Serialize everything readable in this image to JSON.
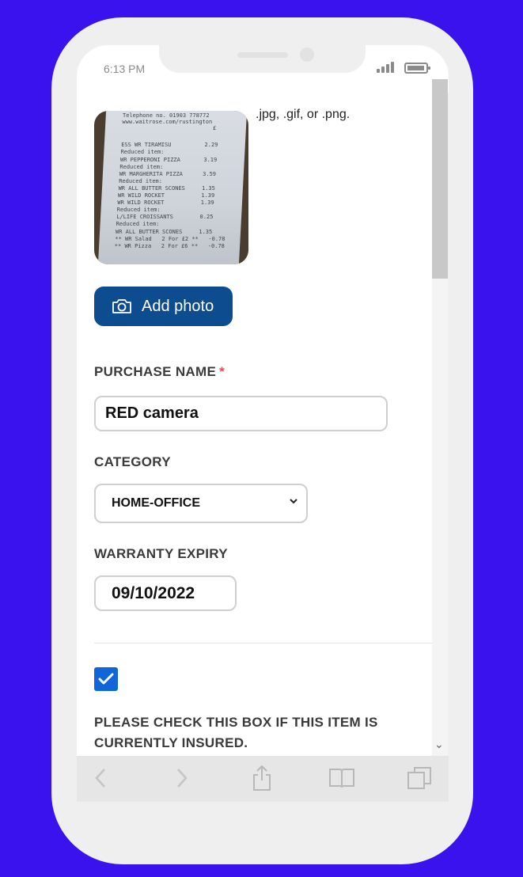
{
  "status_bar": {
    "time": "6:13 PM"
  },
  "upload": {
    "formats_text": ".jpg, .gif, or .png.",
    "add_photo_label": "Add photo",
    "receipt_lines": [
      "Telephone no. 01903 778772",
      "www.waitrose.com/rustington",
      "£",
      "ESS WR TIRAMISU          2.29",
      "Reduced item:",
      "WR PEPPERONI PIZZA       3.19",
      "Reduced item:",
      "WR MARGHERITA PIZZA      3.59",
      "Reduced item:",
      "WR ALL BUTTER SCONES     1.35",
      "WR WILD ROCKET           1.39",
      "WR WILD ROCKET           1.39",
      "Reduced item:",
      "L/LIFE CROISSANTS        0.25",
      "Reduced item:",
      "WR ALL BUTTER SCONES     1.35",
      "** WR Salad   2 For £2 **   -0.78",
      "** WR Pizza   2 For £6 **   -0.78"
    ]
  },
  "form": {
    "purchase_name_label": "PURCHASE NAME",
    "required_marker": "*",
    "purchase_name_value": "RED camera",
    "category_label": "CATEGORY",
    "category_value": "HOME-OFFICE",
    "warranty_label": "WARRANTY EXPIRY",
    "warranty_value": "09/10/2022",
    "insured_checked": true,
    "insured_label": "PLEASE CHECK THIS BOX IF THIS ITEM IS CURRENTLY INSURED."
  },
  "colors": {
    "background": "#3a12ee",
    "primary_button": "#0d4c8e",
    "checkbox": "#1066d8",
    "required": "#e8504a"
  },
  "browser_toolbar": {
    "icons": [
      "back-arrow-icon",
      "forward-arrow-icon",
      "share-icon",
      "bookmarks-icon",
      "tabs-icon"
    ]
  }
}
